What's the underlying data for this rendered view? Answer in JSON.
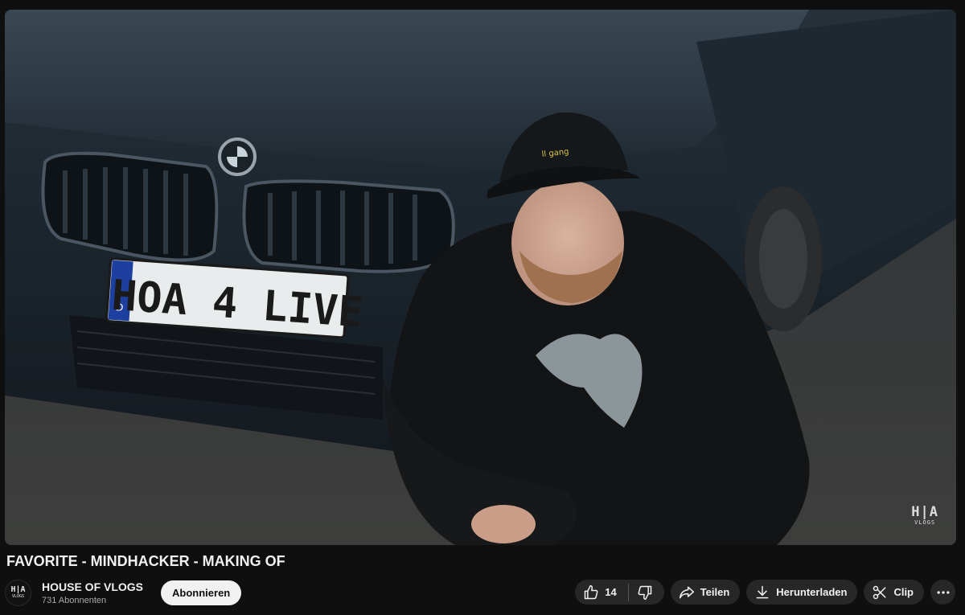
{
  "video": {
    "title": "FAVORITE - MINDHACKER - MAKING OF",
    "license_plate": "HOA 4 LIVE",
    "plate_country": "D",
    "cap_text": "ll gang",
    "watermark": {
      "main": "H|A",
      "sub": "VLOGS"
    }
  },
  "channel": {
    "name": "HOUSE OF VLOGS",
    "subscribers": "731 Abonnenten",
    "avatar": {
      "main": "H|A",
      "sub": "VLOGS"
    },
    "subscribe_label": "Abonnieren"
  },
  "actions": {
    "like_count": "14",
    "share_label": "Teilen",
    "download_label": "Herunterladen",
    "clip_label": "Clip"
  },
  "icons": {
    "like": "thumbs-up-icon",
    "dislike": "thumbs-down-icon",
    "share": "share-arrow-icon",
    "download": "download-icon",
    "clip": "scissors-icon",
    "more": "more-horizontal-icon"
  },
  "colors": {
    "page_bg": "#0f0f0f",
    "pill_bg": "#272727",
    "subscribe_bg": "#f1f1f1",
    "text_primary": "#f1f1f1",
    "text_secondary": "#aaaaaa"
  }
}
